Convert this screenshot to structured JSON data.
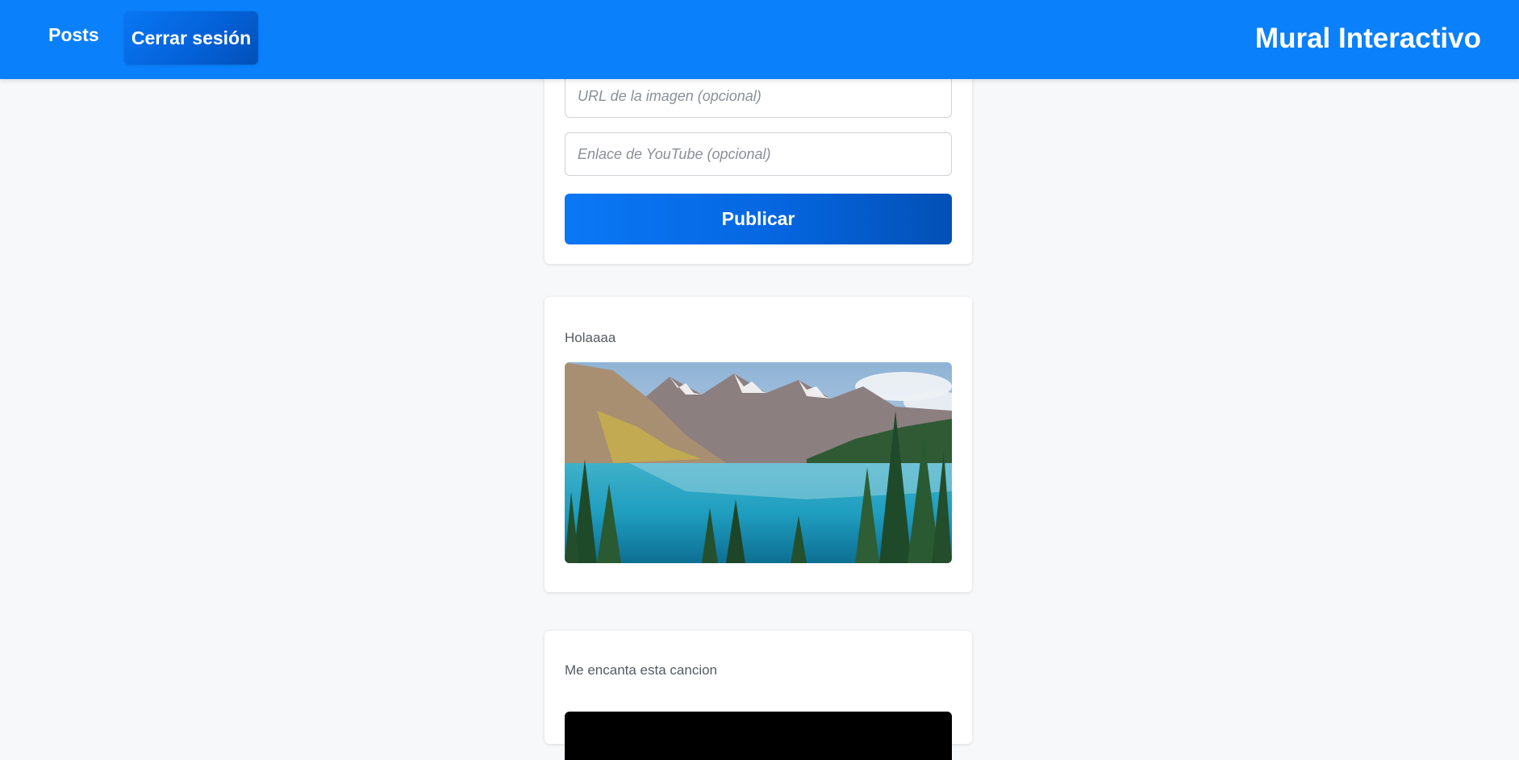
{
  "header": {
    "nav_posts": "Posts",
    "logout_label": "Cerrar sesión",
    "brand": "Mural Interactivo",
    "background_color": "#0b80fb"
  },
  "form": {
    "image_url_placeholder": "URL de la imagen (opcional)",
    "youtube_placeholder": "Enlace de YouTube (opcional)",
    "publish_label": "Publicar"
  },
  "posts": [
    {
      "text": "Holaaaa",
      "media": "landscape-image"
    },
    {
      "text": "Me encanta esta cancion",
      "media": "youtube-embed"
    }
  ]
}
